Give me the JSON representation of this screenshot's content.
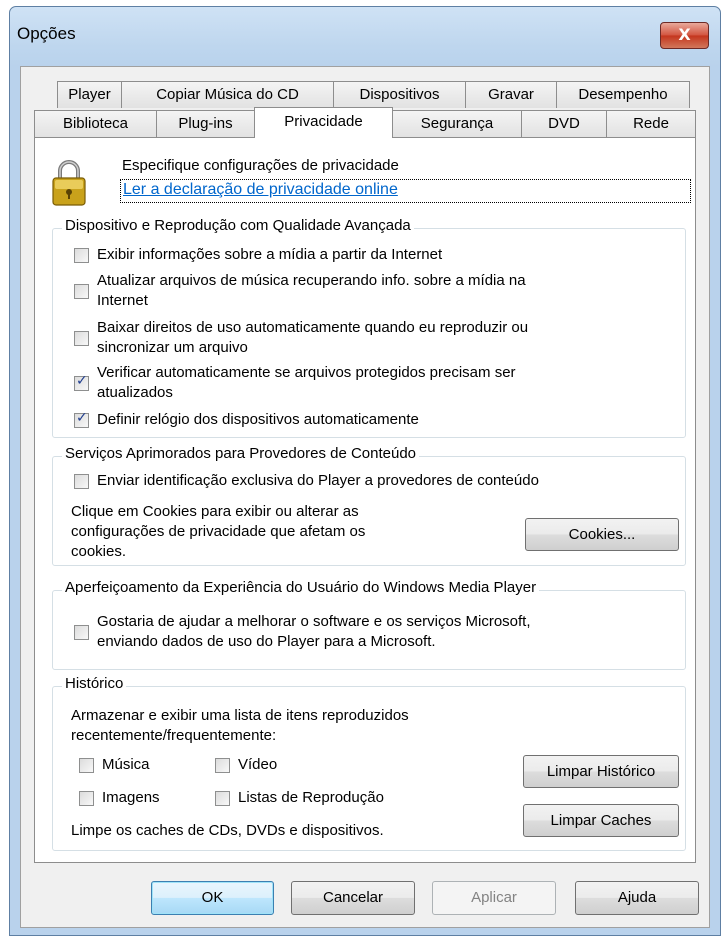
{
  "window": {
    "title": "Opções",
    "close_symbol": "X"
  },
  "tabs_row1": [
    {
      "label": "Player"
    },
    {
      "label": "Copiar Música do CD"
    },
    {
      "label": "Dispositivos"
    },
    {
      "label": "Gravar"
    },
    {
      "label": "Desempenho"
    }
  ],
  "tabs_row2": [
    {
      "label": "Biblioteca"
    },
    {
      "label": "Plug-ins"
    },
    {
      "label": "Privacidade",
      "active": true
    },
    {
      "label": "Segurança"
    },
    {
      "label": "DVD"
    },
    {
      "label": "Rede"
    }
  ],
  "header": {
    "icon": "lock-icon",
    "text": "Especifique configurações de privacidade",
    "link": "Ler a declaração de privacidade online"
  },
  "group_playback": {
    "label": "Dispositivo e Reprodução com Qualidade Avançada",
    "items": [
      {
        "line1": "Exibir informações sobre a mídia a partir da Internet",
        "line2": "",
        "checked": false
      },
      {
        "line1": "Atualizar arquivos de música recuperando info. sobre a mídia na",
        "line2": "Internet",
        "checked": false
      },
      {
        "line1": "Baixar direitos de uso automaticamente quando eu reproduzir ou",
        "line2": "sincronizar um arquivo",
        "checked": false
      },
      {
        "line1": "Verificar automaticamente se arquivos protegidos precisam ser",
        "line2": "atualizados",
        "checked": true
      },
      {
        "line1": "Definir relógio dos dispositivos automaticamente",
        "line2": "",
        "checked": true
      }
    ]
  },
  "group_services": {
    "label": "Serviços Aprimorados para Provedores de Conteúdo",
    "checkbox_label": "Enviar identificação exclusiva do Player a provedores de conteúdo",
    "checked": false,
    "info_line1": "Clique em Cookies para exibir ou alterar as",
    "info_line2": "configurações de privacidade que afetam os",
    "info_line3": "cookies.",
    "cookies_button": "Cookies..."
  },
  "group_ceip": {
    "label": "Aperfeiçoamento da Experiência do Usuário do Windows Media Player",
    "line1": "Gostaria de ajudar a melhorar o software e os serviços Microsoft,",
    "line2": "enviando dados de uso do Player para a Microsoft.",
    "checked": false
  },
  "group_history": {
    "label": "Histórico",
    "desc_line1": "Armazenar e exibir uma lista de itens reproduzidos",
    "desc_line2": "recentemente/frequentemente:",
    "music": "Música",
    "video": "Vídeo",
    "images": "Imagens",
    "playlists": "Listas de Reprodução",
    "clear_history_button": "Limpar Histórico",
    "caches_text": "Limpe os caches de CDs, DVDs e dispositivos.",
    "clear_caches_button": "Limpar Caches"
  },
  "footer": {
    "ok": "OK",
    "cancel": "Cancelar",
    "apply": "Aplicar",
    "help": "Ajuda"
  }
}
